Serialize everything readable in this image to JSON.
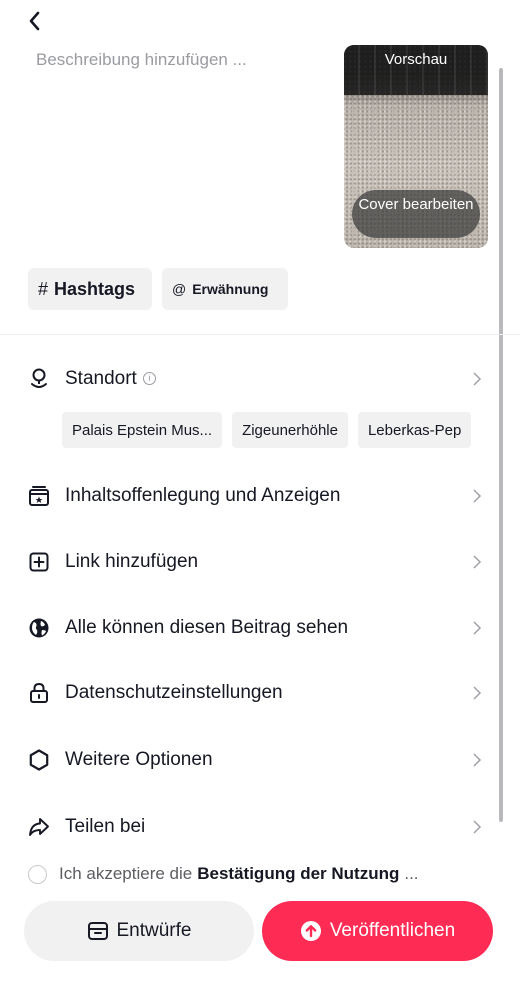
{
  "description": {
    "placeholder": "Beschreibung hinzufügen ..."
  },
  "preview": {
    "label": "Vorschau",
    "cover_button": "Cover bearbeiten"
  },
  "chips": {
    "hashtag_symbol": "#",
    "hashtag_label": "Hashtags",
    "mention_symbol": "@",
    "mention_label": "Erwähnung"
  },
  "location": {
    "label": "Standort",
    "suggestions": [
      "Palais Epstein Mus...",
      "Zigeunerhöhle",
      "Leberkas-Pep"
    ]
  },
  "menu": {
    "disclosure": "Inhaltsoffenlegung und Anzeigen",
    "add_link": "Link hinzufügen",
    "visibility": "Alle können diesen Beitrag sehen",
    "privacy": "Datenschutzeinstellungen",
    "more_options": "Weitere Optionen",
    "share": "Teilen bei"
  },
  "consent": {
    "prefix": "Ich akzeptiere die",
    "link": "Bestätigung der Nutzung",
    "suffix": "..."
  },
  "actions": {
    "drafts": "Entwürfe",
    "publish": "Veröffentlichen"
  },
  "colors": {
    "accent": "#fe2c55",
    "chip_bg": "#f1f1f2",
    "text": "#161823",
    "muted": "#9a9ba1"
  }
}
